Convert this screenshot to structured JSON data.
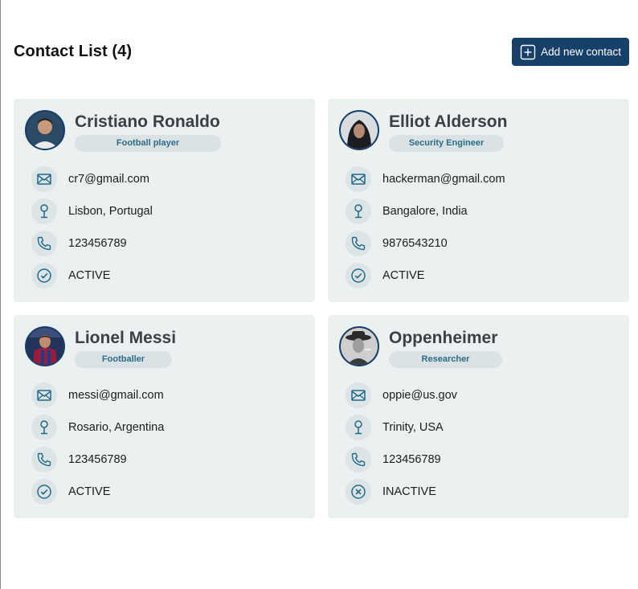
{
  "header": {
    "title": "Contact List (4)",
    "add_button_label": "Add new contact"
  },
  "colors": {
    "primary": "#163f6a",
    "card_bg": "#ebf0f1",
    "pill_bg": "#dbe2e5",
    "pill_text": "#2a6b86",
    "icon_stroke": "#1f6a8a"
  },
  "contacts": [
    {
      "name": "Cristiano Ronaldo",
      "role": "Football player",
      "email": "cr7@gmail.com",
      "location": "Lisbon, Portugal",
      "phone": "123456789",
      "status": "ACTIVE",
      "status_icon": "check-circle-icon"
    },
    {
      "name": "Elliot Alderson",
      "role": "Security Engineer",
      "email": "hackerman@gmail.com",
      "location": "Bangalore, India",
      "phone": "9876543210",
      "status": "ACTIVE",
      "status_icon": "check-circle-icon"
    },
    {
      "name": "Lionel Messi",
      "role": "Footballer",
      "email": "messi@gmail.com",
      "location": "Rosario, Argentina",
      "phone": "123456789",
      "status": "ACTIVE",
      "status_icon": "check-circle-icon"
    },
    {
      "name": "Oppenheimer",
      "role": "Researcher",
      "email": "oppie@us.gov",
      "location": "Trinity, USA",
      "phone": "123456789",
      "status": "INACTIVE",
      "status_icon": "x-circle-icon"
    }
  ]
}
